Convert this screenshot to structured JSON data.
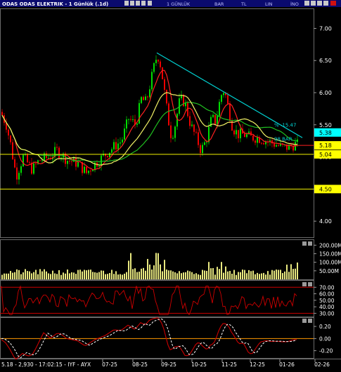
{
  "window": {
    "title": "ODAS ODAS ELEKTRIK - 1 Günlük (.1d)",
    "toolbar_labels": [
      "1 GÜNLÜK",
      "BAR",
      "TL",
      "LIN",
      "İNO"
    ]
  },
  "status_bar": {
    "text": "5.18 - 2,930 - 17:02:15 - IYF - AYX"
  },
  "chart_data": [
    {
      "type": "candlestick",
      "title": "ODAS ODAS ELEKTRIK - 1 Günlük (.1d)",
      "x_ticks": [
        "07-25",
        "08-25",
        "09-25",
        "10-25",
        "11-25",
        "12-25",
        "01-26",
        "02-26"
      ],
      "y_ticks": [
        7.0,
        6.5,
        6.0,
        5.5,
        5.0,
        4.5,
        4.0
      ],
      "ylim": [
        3.75,
        7.3
      ],
      "price_path": [
        [
          0,
          5.7
        ],
        [
          8,
          5.5
        ],
        [
          14,
          5.2
        ],
        [
          22,
          4.7
        ],
        [
          32,
          5.0
        ],
        [
          45,
          4.8
        ],
        [
          55,
          4.95
        ],
        [
          70,
          5.0
        ],
        [
          80,
          5.1
        ],
        [
          95,
          4.95
        ],
        [
          110,
          4.9
        ],
        [
          122,
          4.75
        ],
        [
          130,
          4.85
        ],
        [
          140,
          4.95
        ],
        [
          150,
          5.05
        ],
        [
          160,
          5.15
        ],
        [
          172,
          5.25
        ],
        [
          182,
          5.6
        ],
        [
          192,
          5.5
        ],
        [
          200,
          5.9
        ],
        [
          207,
          5.85
        ],
        [
          214,
          6.2
        ],
        [
          219,
          6.45
        ],
        [
          223,
          6.6
        ],
        [
          228,
          6.4
        ],
        [
          233,
          6.0
        ],
        [
          238,
          5.6
        ],
        [
          243,
          5.3
        ],
        [
          248,
          5.5
        ],
        [
          255,
          5.9
        ],
        [
          262,
          5.85
        ],
        [
          270,
          5.5
        ],
        [
          278,
          5.3
        ],
        [
          285,
          5.1
        ],
        [
          292,
          5.25
        ],
        [
          300,
          5.6
        ],
        [
          306,
          5.55
        ],
        [
          313,
          5.95
        ],
        [
          318,
          6.05
        ],
        [
          324,
          5.75
        ],
        [
          330,
          5.45
        ],
        [
          338,
          5.35
        ],
        [
          346,
          5.35
        ],
        [
          356,
          5.3
        ],
        [
          366,
          5.3
        ],
        [
          378,
          5.25
        ],
        [
          390,
          5.2
        ],
        [
          400,
          5.15
        ],
        [
          410,
          5.15
        ],
        [
          418,
          5.2
        ],
        [
          424,
          5.18
        ]
      ],
      "horizontal_lines": [
        {
          "value": 5.04,
          "color": "#f2f200"
        },
        {
          "value": 4.5,
          "color": "#f2f200"
        }
      ],
      "trendline": {
        "color": "#00d0d0",
        "from": {
          "x_pos": 223,
          "y": 6.62
        },
        "to": {
          "x_pos": 430,
          "y": 5.3
        }
      },
      "price_labels": [
        {
          "value": 5.38,
          "text": "5.38",
          "bg": "#00ffff"
        },
        {
          "value": 5.18,
          "text": "5.18",
          "bg": "#ffff00"
        },
        {
          "value": 5.04,
          "text": "5.04",
          "bg": "#ffff00"
        },
        {
          "value": 4.5,
          "text": "4.50",
          "bg": "#ffff00"
        }
      ],
      "annotations": [
        {
          "text": "% -15.47",
          "color": "#00d0d0"
        },
        {
          "text": "98 BAR",
          "color": "#00d0d0"
        }
      ],
      "series": [
        {
          "color": "#ff2020",
          "role": "ma-short"
        },
        {
          "color": "#20c020",
          "role": "ma-long"
        },
        {
          "color": "#f2f266",
          "role": "ma-mid"
        }
      ],
      "grid": false
    },
    {
      "type": "bar",
      "y_ticks": [
        "200.00M",
        "150.00M",
        "100.00M",
        "50.00M"
      ],
      "ylim": [
        0,
        230
      ],
      "color": "#e8e880"
    },
    {
      "type": "line",
      "y_ticks": [
        "70.00",
        "60.00",
        "50.00",
        "40.00",
        "30.00"
      ],
      "ylim": [
        25,
        80
      ],
      "bands": [
        70,
        30
      ],
      "color": "#cc0000"
    },
    {
      "type": "line",
      "y_ticks": [
        "0.20",
        "0.00",
        "-0.20"
      ],
      "ylim": [
        -0.32,
        0.34
      ],
      "zero_line_color": "#ff9900",
      "series": [
        {
          "color": "#cc0000",
          "style": "solid"
        },
        {
          "color": "#ffffff",
          "style": "dashed"
        }
      ]
    }
  ]
}
